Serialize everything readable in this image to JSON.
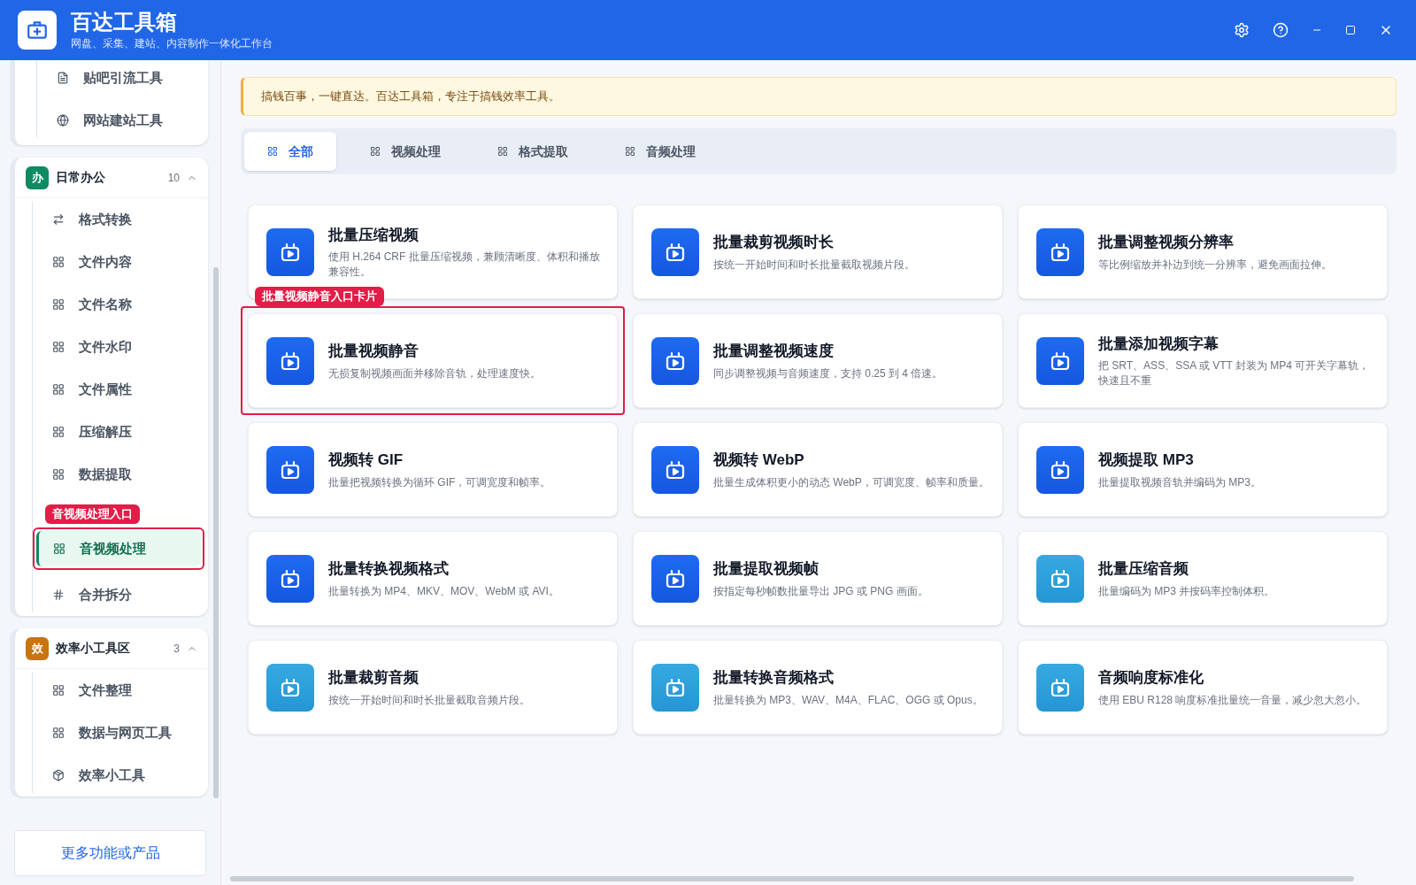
{
  "app": {
    "title": "百达工具箱",
    "subtitle": "网盘、采集、建站、内容制作一体化工作台"
  },
  "sidebar": {
    "partial_group": {
      "items": [
        {
          "label": "贴吧引流工具",
          "kind": "doc",
          "selected": false
        },
        {
          "label": "网站建站工具",
          "kind": "globe",
          "selected": false
        }
      ]
    },
    "groups": [
      {
        "badge": "办",
        "color": "#0f8a63",
        "title": "日常办公",
        "count": "10",
        "expanded": true,
        "items": [
          {
            "label": "格式转换",
            "kind": "swap",
            "selected": false
          },
          {
            "label": "文件内容",
            "kind": "grid",
            "selected": false
          },
          {
            "label": "文件名称",
            "kind": "grid",
            "selected": false
          },
          {
            "label": "文件水印",
            "kind": "grid",
            "selected": false
          },
          {
            "label": "文件属性",
            "kind": "grid",
            "selected": false
          },
          {
            "label": "压缩解压",
            "kind": "grid",
            "selected": false
          },
          {
            "label": "数据提取",
            "kind": "grid",
            "selected": false
          },
          {
            "label": "音视频处理",
            "kind": "grid",
            "selected": true,
            "callout": "音视频处理入口"
          },
          {
            "label": "合并拆分",
            "kind": "hash",
            "selected": false
          }
        ]
      },
      {
        "badge": "效",
        "color": "#c8740f",
        "title": "效率小工具区",
        "count": "3",
        "expanded": true,
        "items": [
          {
            "label": "文件整理",
            "kind": "grid",
            "selected": false
          },
          {
            "label": "数据与网页工具",
            "kind": "grid",
            "selected": false
          },
          {
            "label": "效率小工具",
            "kind": "box",
            "selected": false
          }
        ]
      }
    ],
    "footer_button": "更多功能或产品"
  },
  "notice": "搞钱百事，一键直达。百达工具箱，专注于搞钱效率工具。",
  "tabs": [
    {
      "label": "全部",
      "selected": true
    },
    {
      "label": "视频处理",
      "selected": false
    },
    {
      "label": "格式提取",
      "selected": false
    },
    {
      "label": "音频处理",
      "selected": false
    }
  ],
  "cards": [
    {
      "kind": "video",
      "title": "批量压缩视频",
      "description": "使用 H.264 CRF 批量压缩视频，兼顾清晰度、体积和播放兼容性。"
    },
    {
      "kind": "video",
      "title": "批量裁剪视频时长",
      "description": "按统一开始时间和时长批量截取视频片段。"
    },
    {
      "kind": "video",
      "title": "批量调整视频分辨率",
      "description": "等比例缩放并补边到统一分辨率，避免画面拉伸。"
    },
    {
      "kind": "video",
      "title": "批量视频静音",
      "description": "无损复制视频画面并移除音轨，处理速度快。",
      "callout": "批量视频静音入口卡片"
    },
    {
      "kind": "video",
      "title": "批量调整视频速度",
      "description": "同步调整视频与音频速度，支持 0.25 到 4 倍速。"
    },
    {
      "kind": "video",
      "title": "批量添加视频字幕",
      "description": "把 SRT、ASS、SSA 或 VTT 封装为 MP4 可开关字幕轨，快速且不重"
    },
    {
      "kind": "video",
      "title": "视频转 GIF",
      "description": "批量把视频转换为循环 GIF，可调宽度和帧率。"
    },
    {
      "kind": "video",
      "title": "视频转 WebP",
      "description": "批量生成体积更小的动态 WebP，可调宽度、帧率和质量。"
    },
    {
      "kind": "video",
      "title": "视频提取 MP3",
      "description": "批量提取视频音轨并编码为 MP3。"
    },
    {
      "kind": "video",
      "title": "批量转换视频格式",
      "description": "批量转换为 MP4、MKV、MOV、WebM 或 AVI。"
    },
    {
      "kind": "video",
      "title": "批量提取视频帧",
      "description": "按指定每秒帧数批量导出 JPG 或 PNG 画面。"
    },
    {
      "kind": "audio",
      "title": "批量压缩音频",
      "description": "批量编码为 MP3 并按码率控制体积。"
    },
    {
      "kind": "audio",
      "title": "批量裁剪音频",
      "description": "按统一开始时间和时长批量截取音频片段。"
    },
    {
      "kind": "audio",
      "title": "批量转换音频格式",
      "description": "批量转换为 MP3、WAV、M4A、FLAC、OGG 或 Opus。"
    },
    {
      "kind": "audio",
      "title": "音频响度标准化",
      "description": "使用 EBU R128 响度标准批量统一音量，减少忽大忽小。"
    }
  ]
}
